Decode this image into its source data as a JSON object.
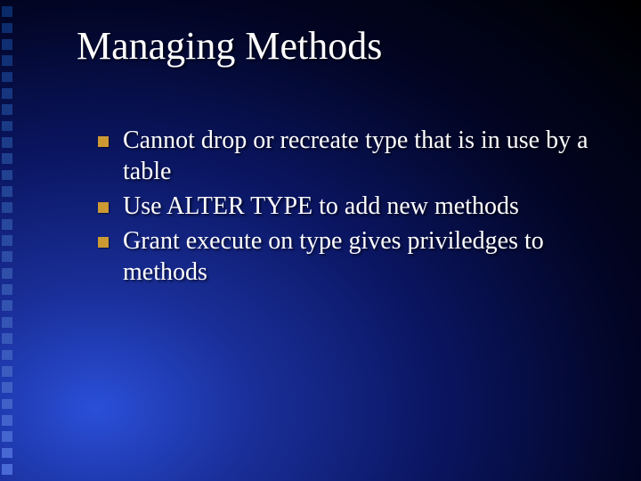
{
  "title": "Managing Methods",
  "bullets": [
    "Cannot drop or recreate type that is in use by a table",
    "Use ALTER TYPE to add new methods",
    "Grant execute on type gives priviledges to methods"
  ],
  "colors": {
    "bullet": "#cc9933",
    "edge_top": "#0a2a6a",
    "edge_bottom": "#4a6ad8"
  }
}
